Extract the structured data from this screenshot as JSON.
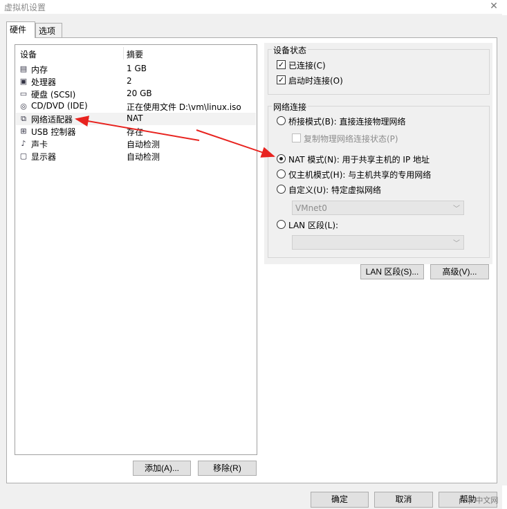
{
  "window": {
    "title": "虚拟机设置",
    "close_glyph": "✕"
  },
  "tabs": [
    {
      "label": "硬件",
      "active": true
    },
    {
      "label": "选项",
      "active": false
    }
  ],
  "device_list": {
    "columns": [
      "设备",
      "摘要"
    ],
    "rows": [
      {
        "icon": "memory-icon",
        "name": "内存",
        "summary": "1 GB",
        "selected": false
      },
      {
        "icon": "processor-icon",
        "name": "处理器",
        "summary": "2",
        "selected": false
      },
      {
        "icon": "hard-disk-icon",
        "name": "硬盘 (SCSI)",
        "summary": "20 GB",
        "selected": false
      },
      {
        "icon": "cd-dvd-icon",
        "name": "CD/DVD (IDE)",
        "summary": "正在使用文件 D:\\vm\\linux.iso",
        "selected": false
      },
      {
        "icon": "network-adapter-icon",
        "name": "网络适配器",
        "summary": "NAT",
        "selected": true
      },
      {
        "icon": "usb-icon",
        "name": "USB 控制器",
        "summary": "存在",
        "selected": false
      },
      {
        "icon": "sound-card-icon",
        "name": "声卡",
        "summary": "自动检测",
        "selected": false
      },
      {
        "icon": "display-icon",
        "name": "显示器",
        "summary": "自动检测",
        "selected": false
      }
    ],
    "add_button": "添加(A)...",
    "remove_button": "移除(R)"
  },
  "device_status": {
    "title": "设备状态",
    "connected": {
      "label": "已连接(C)",
      "checked": true
    },
    "connect_at_power_on": {
      "label": "启动时连接(O)",
      "checked": true
    }
  },
  "network_connection": {
    "title": "网络连接",
    "bridged": {
      "label": "桥接模式(B): 直接连接物理网络",
      "selected": false
    },
    "replicate_state": {
      "label": "复制物理网络连接状态(P)",
      "checked": false,
      "disabled": true
    },
    "nat": {
      "label": "NAT 模式(N): 用于共享主机的 IP 地址",
      "selected": true
    },
    "host_only": {
      "label": "仅主机模式(H): 与主机共享的专用网络",
      "selected": false
    },
    "custom": {
      "label": "自定义(U): 特定虚拟网络",
      "selected": false
    },
    "custom_select_value": "VMnet0",
    "lan_segment": {
      "label": "LAN 区段(L):",
      "selected": false
    },
    "lan_select_value": ""
  },
  "buttons": {
    "lan_segments": "LAN 区段(S)...",
    "advanced": "高级(V)...",
    "ok": "确定",
    "cancel": "取消",
    "help": "帮助"
  },
  "watermark": "php 中文网",
  "colors": {
    "annotation_arrow": "#e8231f",
    "selected_row": "#f2f2f2",
    "dialog_bg": "#f0f0f0"
  }
}
